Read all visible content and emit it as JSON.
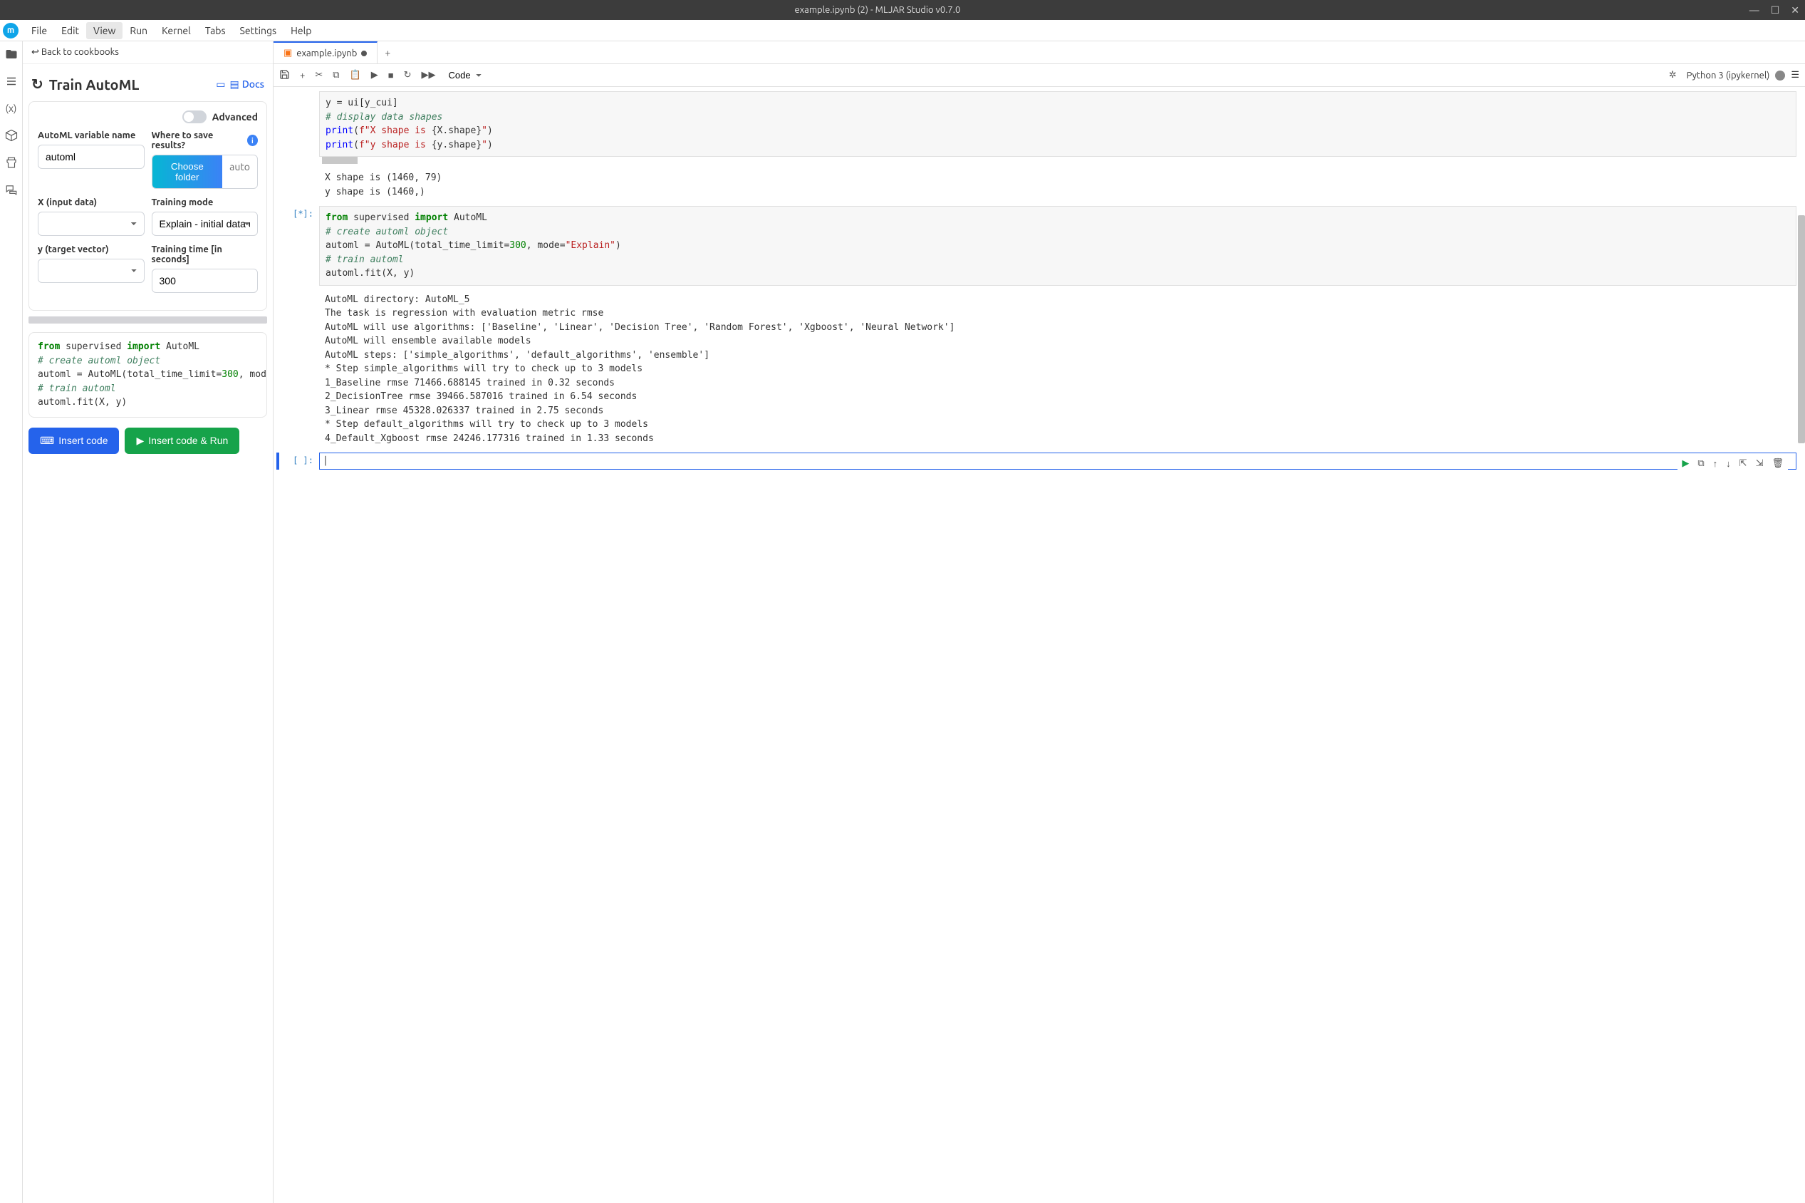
{
  "titlebar": {
    "title": "example.ipynb (2) - MLJAR Studio v0.7.0"
  },
  "menubar": [
    "File",
    "Edit",
    "View",
    "Run",
    "Kernel",
    "Tabs",
    "Settings",
    "Help"
  ],
  "back_link": "↩ Back to cookbooks",
  "panel": {
    "title": "Train AutoML",
    "docs": "Docs",
    "advanced": "Advanced",
    "fields": {
      "var_name_label": "AutoML variable name",
      "var_name_value": "automl",
      "save_label": "Where to save results?",
      "choose_folder": "Choose folder",
      "folder_value": "auto",
      "x_label": "X (input data)",
      "x_value": "",
      "mode_label": "Training mode",
      "mode_value": "Explain - initial data exploration",
      "y_label": "y (target vector)",
      "y_value": "",
      "time_label": "Training time [in seconds]",
      "time_value": "300"
    },
    "insert_code": "Insert code",
    "insert_run": "Insert code & Run"
  },
  "tab": {
    "name": "example.ipynb"
  },
  "toolbar": {
    "cell_type": "Code",
    "kernel": "Python 3 (ipykernel)"
  },
  "cell0_output": "X shape is (1460, 79)\ny shape is (1460,)",
  "cell1_prompt": "[*]:",
  "cell1_output": "AutoML directory: AutoML_5\nThe task is regression with evaluation metric rmse\nAutoML will use algorithms: ['Baseline', 'Linear', 'Decision Tree', 'Random Forest', 'Xgboost', 'Neural Network']\nAutoML will ensemble available models\nAutoML steps: ['simple_algorithms', 'default_algorithms', 'ensemble']\n* Step simple_algorithms will try to check up to 3 models\n1_Baseline rmse 71466.688145 trained in 0.32 seconds\n2_DecisionTree rmse 39466.587016 trained in 6.54 seconds\n3_Linear rmse 45328.026337 trained in 2.75 seconds\n* Step default_algorithms will try to check up to 3 models\n4_Default_Xgboost rmse 24246.177316 trained in 1.33 seconds",
  "cell2_prompt": "[ ]:"
}
